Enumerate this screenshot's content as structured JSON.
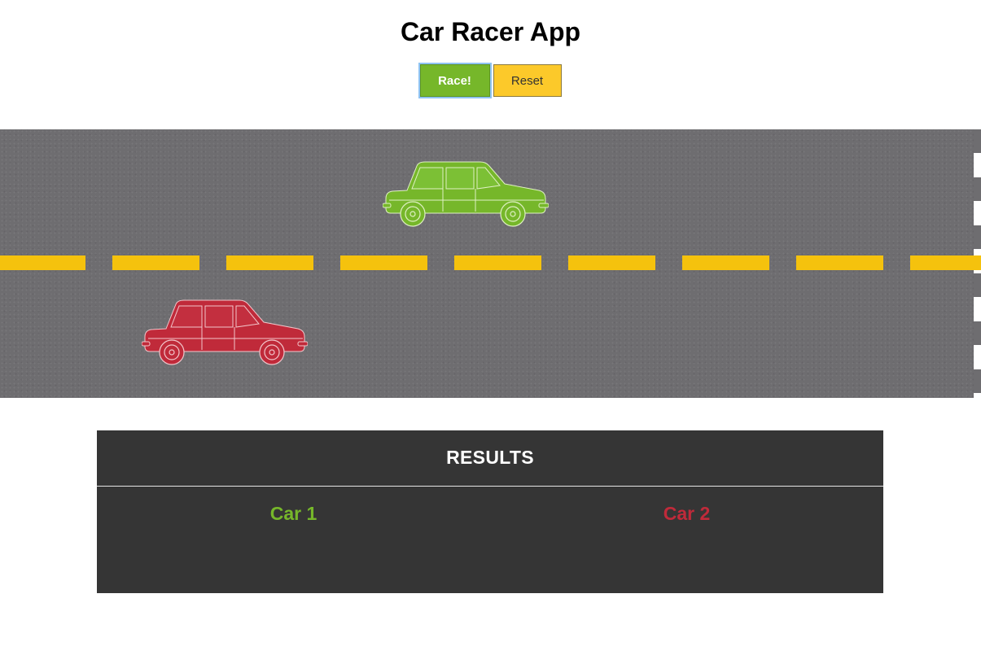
{
  "app": {
    "title": "Car Racer App"
  },
  "controls": {
    "race_label": "Race!",
    "reset_label": "Reset"
  },
  "cars": [
    {
      "id": "car-1",
      "color": "#76b72a",
      "lane": "top"
    },
    {
      "id": "car-2",
      "color": "#c02a3a",
      "lane": "bottom"
    }
  ],
  "track": {
    "asphalt_color": "#6e6d70",
    "lane_line_color": "#f5c20d",
    "finish_line": "checkered-white"
  },
  "results": {
    "heading": "RESULTS",
    "car1_label": "Car 1",
    "car2_label": "Car 2",
    "car1_color": "#76b72a",
    "car2_color": "#c02a3a"
  }
}
